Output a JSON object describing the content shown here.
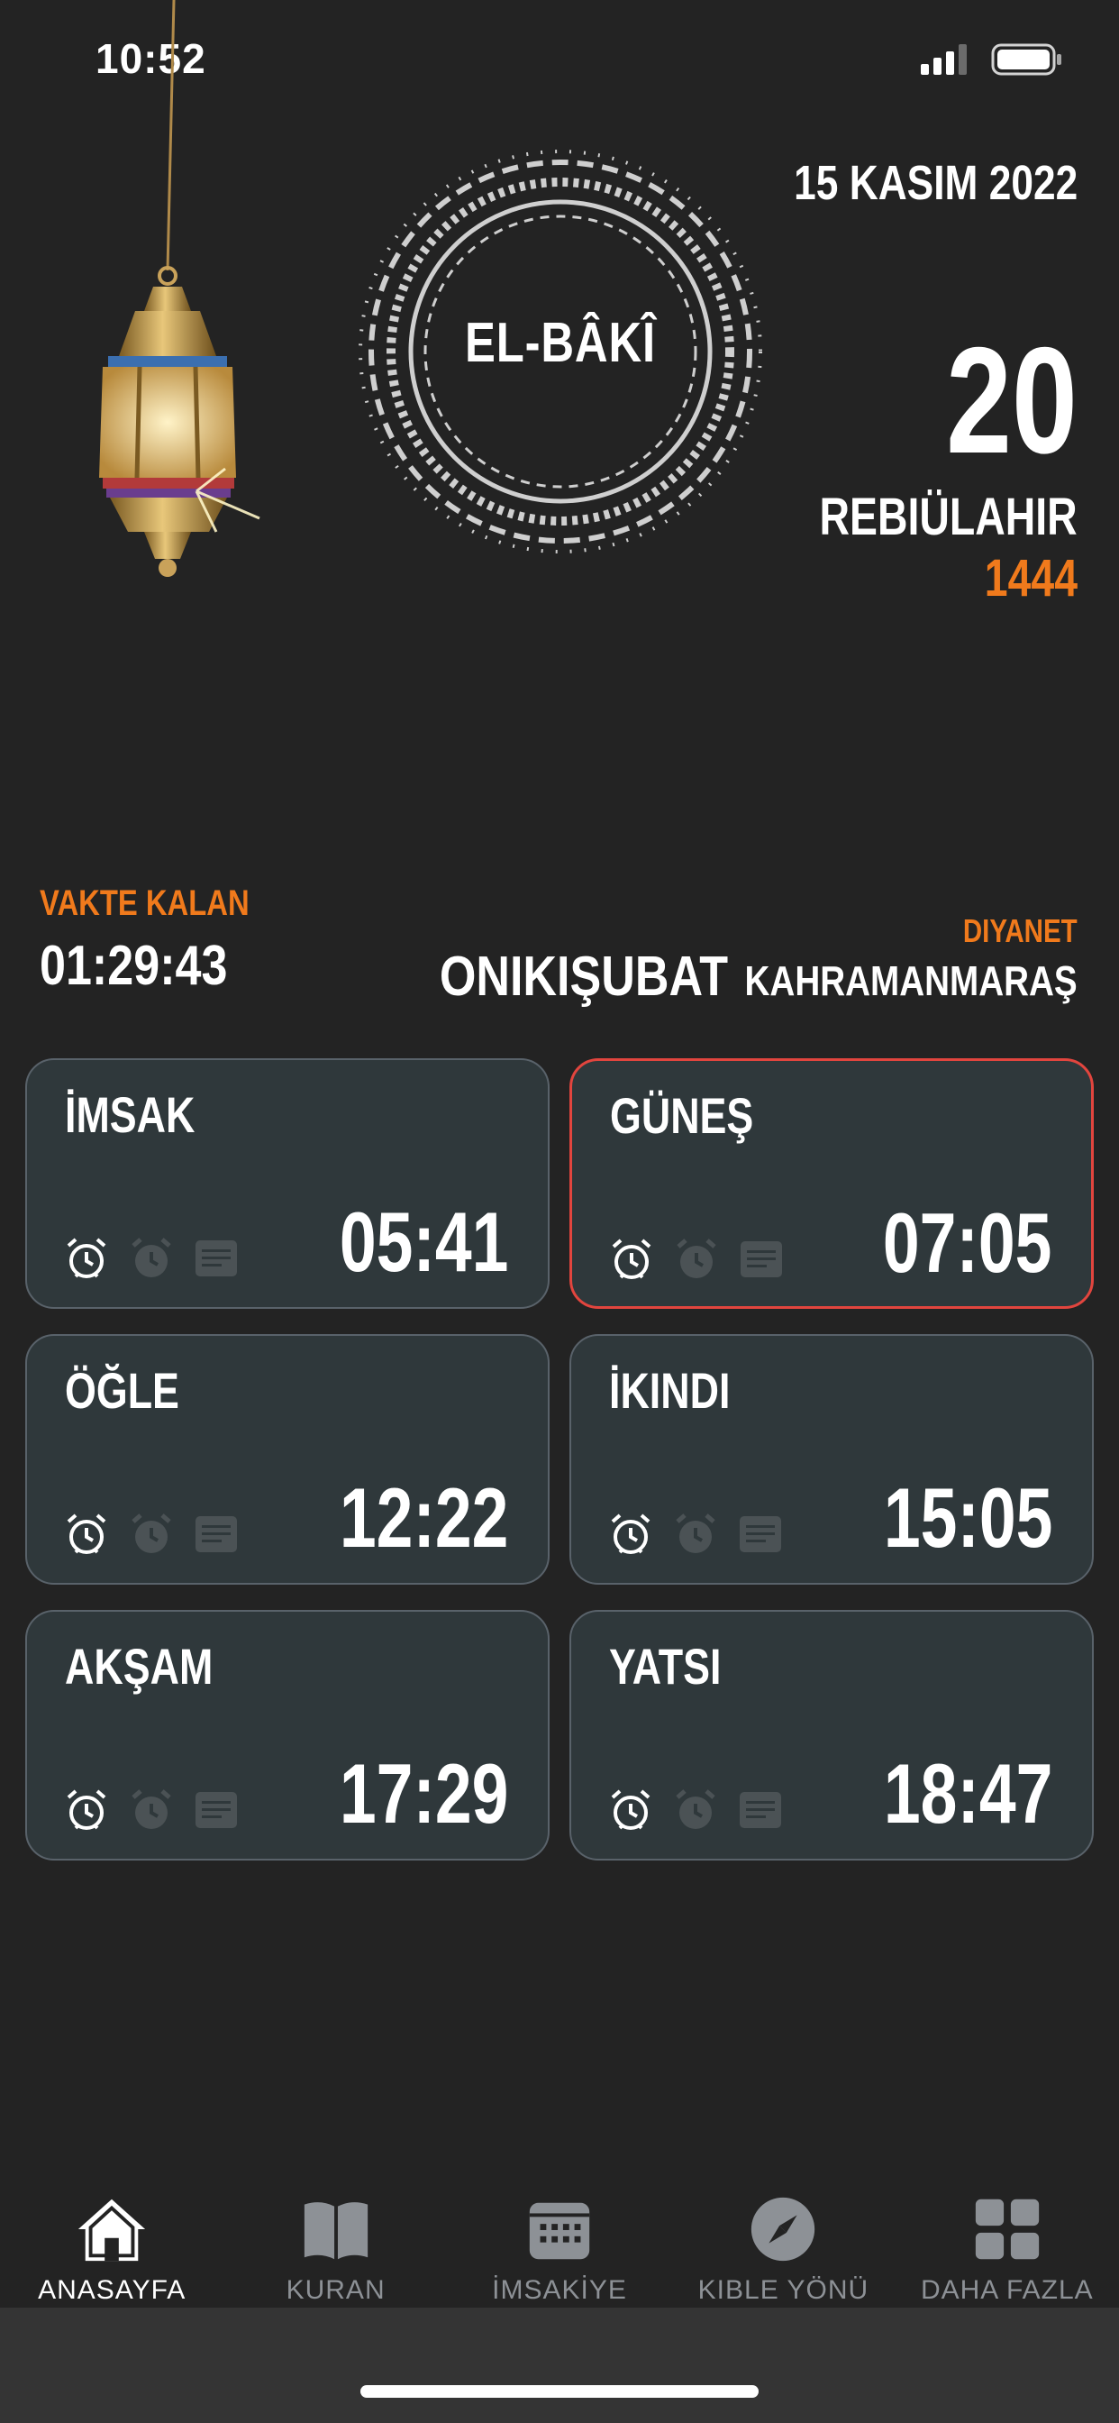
{
  "status_bar": {
    "time": "10:52"
  },
  "header": {
    "esma_name": "EL-BÂKÎ",
    "gregorian_date": "15 KASIM 2022",
    "hijri_day": "20",
    "hijri_month": "REBIÜLAHIR",
    "hijri_year": "1444"
  },
  "countdown": {
    "label": "VAKTE KALAN",
    "value": "01:29:43"
  },
  "location": {
    "source": "DIYANET",
    "district": "ONIKIŞUBAT",
    "province": "KAHRAMANMARAŞ"
  },
  "prayers": [
    {
      "name": "İMSAK",
      "time": "05:41"
    },
    {
      "name": "GÜNEŞ",
      "time": "07:05"
    },
    {
      "name": "ÖĞLE",
      "time": "12:22"
    },
    {
      "name": "İKINDI",
      "time": "15:05"
    },
    {
      "name": "AKŞAM",
      "time": "17:29"
    },
    {
      "name": "YATSI",
      "time": "18:47"
    }
  ],
  "tabs": [
    {
      "label": "ANASAYFA",
      "icon": "home-icon"
    },
    {
      "label": "KURAN",
      "icon": "book-icon"
    },
    {
      "label": "İMSAKİYE",
      "icon": "calendar-icon"
    },
    {
      "label": "KIBLE YÖNÜ",
      "icon": "compass-icon"
    },
    {
      "label": "DAHA FAZLA",
      "icon": "grid-icon"
    }
  ],
  "colors": {
    "accent": "#f07a1c",
    "active_border": "#e2453e",
    "card_bg": "#2f383b",
    "background": "#232323"
  }
}
